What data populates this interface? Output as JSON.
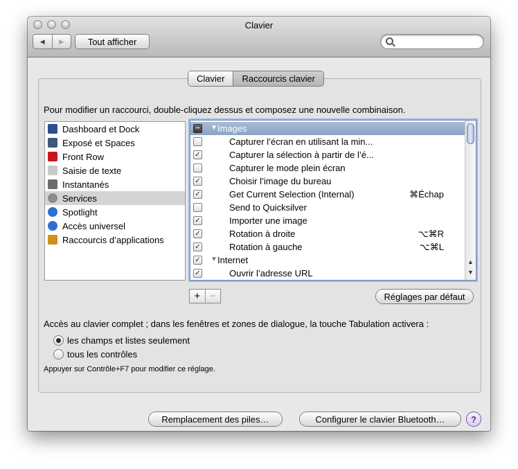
{
  "window": {
    "title": "Clavier"
  },
  "toolbar": {
    "back_glyph": "◀",
    "forward_glyph": "▶",
    "show_all_label": "Tout afficher",
    "search_placeholder": ""
  },
  "tabs": [
    {
      "label": "Clavier",
      "selected": false
    },
    {
      "label": "Raccourcis clavier",
      "selected": true
    }
  ],
  "instructions": "Pour modifier un raccourci, double-cliquez dessus et composez une nouvelle combinaison.",
  "categories": [
    {
      "label": "Dashboard et Dock",
      "icon": "dashboard-dock-icon",
      "color": "#2b4f8f"
    },
    {
      "label": "Exposé et Spaces",
      "icon": "expose-spaces-icon",
      "color": "#3d5a78"
    },
    {
      "label": "Front Row",
      "icon": "front-row-icon",
      "color": "#c8141c"
    },
    {
      "label": "Saisie de texte",
      "icon": "text-input-icon",
      "color": "#c9c9c9"
    },
    {
      "label": "Instantanés",
      "icon": "screenshot-icon",
      "color": "#6b6b6b"
    },
    {
      "label": "Services",
      "icon": "services-gear-icon",
      "color": "#8d8d8d",
      "selected": true
    },
    {
      "label": "Spotlight",
      "icon": "spotlight-icon",
      "color": "#2f6fd1"
    },
    {
      "label": "Accès universel",
      "icon": "universal-access-icon",
      "color": "#2f6fd1"
    },
    {
      "label": "Raccourcis d’applications",
      "icon": "app-shortcuts-icon",
      "color": "#d0901c"
    }
  ],
  "shortcuts": [
    {
      "type": "group",
      "label": "Images",
      "checkbox": "−",
      "tri": "▼",
      "selected": true
    },
    {
      "type": "item",
      "label": "Capturer l’écran en utilisant la min...",
      "check": "",
      "key": ""
    },
    {
      "type": "item",
      "label": "Capturer la sélection à partir de l’é...",
      "check": "✓",
      "key": ""
    },
    {
      "type": "item",
      "label": "Capturer le mode plein écran",
      "check": "",
      "key": ""
    },
    {
      "type": "item",
      "label": "Choisir l’image du bureau",
      "check": "✓",
      "key": ""
    },
    {
      "type": "item",
      "label": "Get Current Selection (Internal)",
      "check": "✓",
      "key": "⌘Échap"
    },
    {
      "type": "item",
      "label": "Send to Quicksilver",
      "check": "",
      "key": ""
    },
    {
      "type": "item",
      "label": "Importer une image",
      "check": "✓",
      "key": ""
    },
    {
      "type": "item",
      "label": "Rotation à droite",
      "check": "✓",
      "key": "⌥⌘R"
    },
    {
      "type": "item",
      "label": "Rotation à gauche",
      "check": "✓",
      "key": "⌥⌘L"
    },
    {
      "type": "group",
      "label": "Internet",
      "checkbox": "✓",
      "tri": "▼",
      "selected": false
    },
    {
      "type": "item",
      "label": "Ouvrir l’adresse URL",
      "check": "✓",
      "key": ""
    }
  ],
  "list_controls": {
    "add": "+",
    "remove": "−"
  },
  "defaults_button": "Réglages par défaut",
  "full_access": {
    "label": "Accès au clavier complet ; dans les fenêtres et zones de dialogue, la touche Tabulation activera :",
    "options": [
      {
        "label": "les champs et listes seulement",
        "selected": true
      },
      {
        "label": "tous les contrôles",
        "selected": false
      }
    ],
    "note": "Appuyer sur Contrôle+F7 pour modifier ce réglage."
  },
  "bottom": {
    "battery_button": "Remplacement des piles…",
    "bluetooth_button": "Configurer le clavier Bluetooth…",
    "help": "?"
  }
}
